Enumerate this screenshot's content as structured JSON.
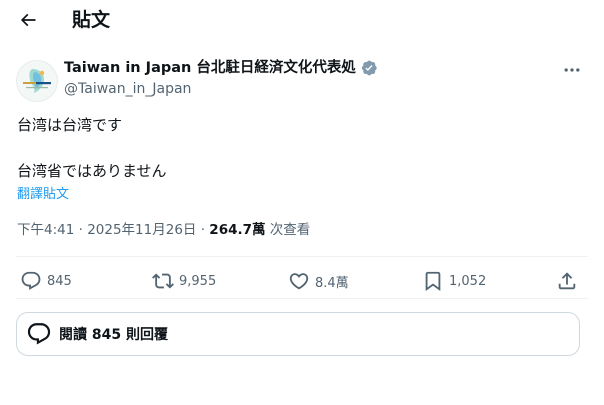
{
  "header": {
    "title": "貼文"
  },
  "author": {
    "name": "Taiwan in Japan 台北駐日経済文化代表処",
    "handle": "@Taiwan_in_Japan",
    "avatar_text": "TAIWAN"
  },
  "tweet": {
    "lines": [
      "台湾は台湾です",
      "",
      "台湾省ではありません"
    ],
    "translate_label": "翻譯貼文"
  },
  "meta": {
    "time": "下午4:41",
    "separator": " · ",
    "date": "2025年11月26日",
    "views": "264.7萬",
    "views_label": " 次查看"
  },
  "actions": {
    "replies": "845",
    "reposts": "9,955",
    "likes": "8.4萬",
    "bookmarks": "1,052"
  },
  "replies_button": {
    "label": "閱讀 845 則回覆"
  },
  "colors": {
    "accent": "#1d9bf0",
    "text": "#0f1419",
    "secondary": "#536471",
    "border": "#cfd9de"
  }
}
